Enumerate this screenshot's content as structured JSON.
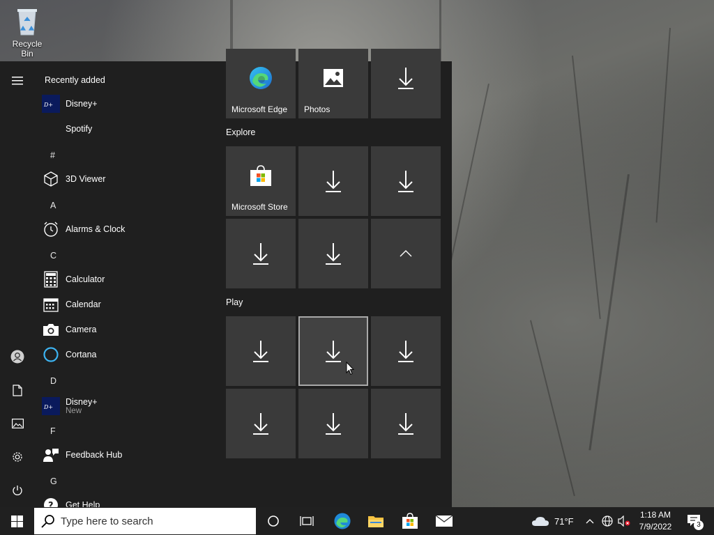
{
  "desktop": {
    "recycle_bin": "Recycle Bin"
  },
  "start_menu": {
    "recently_added_header": "Recently added",
    "recent": [
      {
        "label": "Disney+",
        "icon": "disney-icon"
      },
      {
        "label": "Spotify",
        "icon": "none"
      }
    ],
    "groups": [
      {
        "letter": "#",
        "items": [
          {
            "label": "3D Viewer",
            "icon": "cube-icon"
          }
        ]
      },
      {
        "letter": "A",
        "items": [
          {
            "label": "Alarms & Clock",
            "icon": "clock-icon"
          }
        ]
      },
      {
        "letter": "C",
        "items": [
          {
            "label": "Calculator",
            "icon": "calculator-icon"
          },
          {
            "label": "Calendar",
            "icon": "calendar-icon"
          },
          {
            "label": "Camera",
            "icon": "camera-icon"
          },
          {
            "label": "Cortana",
            "icon": "cortana-icon"
          }
        ]
      },
      {
        "letter": "D",
        "items": [
          {
            "label": "Disney+",
            "sub": "New",
            "icon": "disney-icon"
          }
        ]
      },
      {
        "letter": "F",
        "items": [
          {
            "label": "Feedback Hub",
            "icon": "feedback-icon"
          }
        ]
      },
      {
        "letter": "G",
        "items": [
          {
            "label": "Get Help",
            "icon": "help-icon"
          }
        ]
      }
    ],
    "tiles": {
      "top_row": [
        {
          "label": "Microsoft Edge",
          "icon": "edge-icon"
        },
        {
          "label": "Photos",
          "icon": "photos-icon"
        },
        {
          "label": "",
          "icon": "download-arrow-icon"
        }
      ],
      "explore_title": "Explore",
      "explore": [
        {
          "label": "Microsoft Store",
          "icon": "store-icon"
        },
        {
          "label": "",
          "icon": "download-arrow-icon"
        },
        {
          "label": "",
          "icon": "download-arrow-icon"
        },
        {
          "label": "",
          "icon": "download-arrow-icon"
        },
        {
          "label": "",
          "icon": "download-arrow-icon"
        },
        {
          "label": "",
          "icon": "chevron-up-icon"
        }
      ],
      "play_title": "Play",
      "play_count": 6
    }
  },
  "taskbar": {
    "search_placeholder": "Type here to search",
    "weather": "71°F",
    "time": "1:18 AM",
    "date": "7/9/2022",
    "notification_count": "3"
  },
  "colors": {
    "menu_bg": "#1f1f1f",
    "tile_bg": "#3a3a3a",
    "taskbar_bg": "#202020"
  }
}
